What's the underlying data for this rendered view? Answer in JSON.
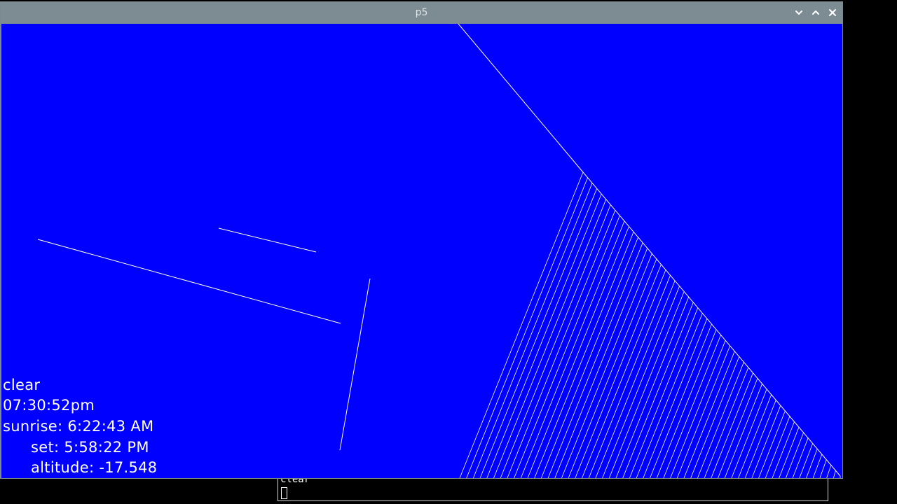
{
  "window": {
    "title": "p5",
    "buttons": [
      "minimize",
      "maximize",
      "close"
    ]
  },
  "canvas": {
    "background_color": "#0000ff",
    "stroke_color": "#ffffff",
    "info": {
      "weather": "clear",
      "time": "07:30:52pm",
      "sunrise": "sunrise: 6:22:43 AM",
      "sunset": "set: 5:58:22 PM",
      "altitude": "altitude: -17.548"
    }
  },
  "terminal": {
    "line": "clear"
  },
  "icons": {
    "minimize": "chevron-down-icon",
    "maximize": "chevron-up-icon",
    "close": "close-icon"
  }
}
